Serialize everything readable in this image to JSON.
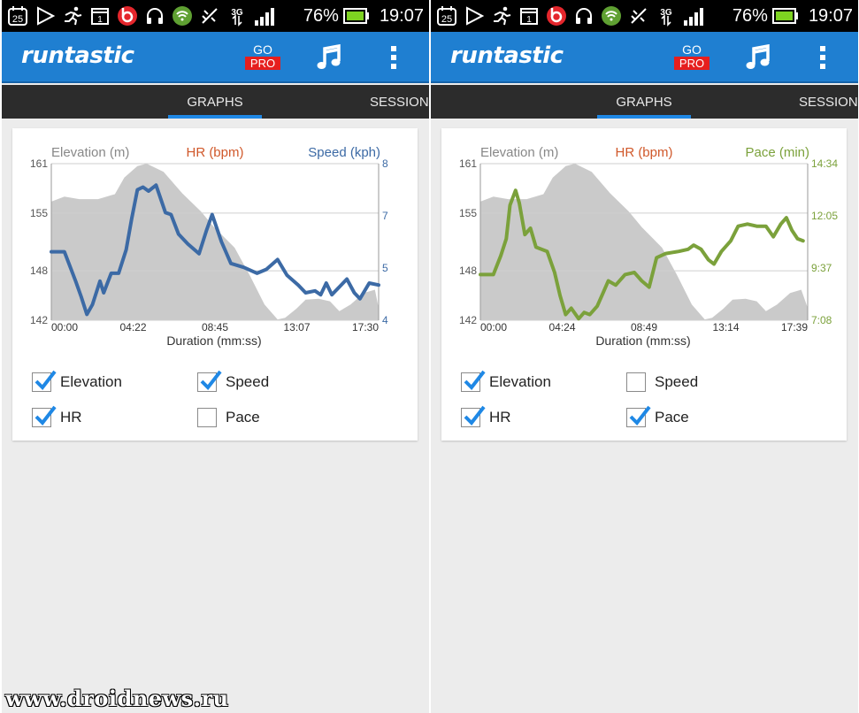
{
  "status_bar": {
    "date_badge": "25",
    "sim_badge": "1",
    "network_label": "3G",
    "battery_percent": "76%",
    "time": "19:07"
  },
  "app": {
    "logo": "runtastic",
    "go_label": "GO",
    "pro_label": "PRO"
  },
  "tabs": {
    "graphs": "GRAPHS",
    "sessions": "SESSION"
  },
  "colors": {
    "appbar": "#1f7fd1",
    "speed": "#3c6aa5",
    "hr": "#d0582a",
    "pace": "#7ba13b",
    "elevation_fill": "#cacaca"
  },
  "watermark": "www.droidnews.ru",
  "panels": [
    {
      "legend": {
        "elevation": "Elevation (m)",
        "hr": "HR (bpm)",
        "right": "Speed (kph)"
      },
      "checkboxes": [
        {
          "label": "Elevation",
          "checked": true
        },
        {
          "label": "Speed",
          "checked": true
        },
        {
          "label": "HR",
          "checked": true
        },
        {
          "label": "Pace",
          "checked": false
        }
      ],
      "chart_data": {
        "type": "line",
        "xlabel": "Duration (mm:ss)",
        "x_ticks": [
          "00:00",
          "04:22",
          "08:45",
          "13:07",
          "17:30"
        ],
        "y_left_label": "Elevation (m)",
        "y_left_ticks": [
          "161",
          "155",
          "148",
          "142"
        ],
        "y_left_range": [
          142,
          161
        ],
        "y_right_label": "Speed (kph)",
        "y_right_ticks": [
          "8",
          "7",
          "5",
          "4"
        ],
        "y_right_range": [
          4,
          8
        ],
        "duration_minutes": 17.5,
        "series": [
          {
            "name": "Elevation (m)",
            "kind": "area",
            "color": "#cacaca",
            "axis": "left",
            "points": [
              [
                0,
                156.4
              ],
              [
                0.7,
                157.0
              ],
              [
                1.5,
                156.7
              ],
              [
                2.5,
                156.7
              ],
              [
                3.4,
                157.3
              ],
              [
                3.9,
                159.3
              ],
              [
                4.6,
                160.7
              ],
              [
                5.1,
                161.0
              ],
              [
                6.0,
                160.0
              ],
              [
                7.0,
                157.4
              ],
              [
                8.0,
                155.2
              ],
              [
                8.7,
                153.3
              ],
              [
                9.8,
                150.8
              ],
              [
                10.6,
                147.5
              ],
              [
                11.4,
                143.9
              ],
              [
                12.1,
                142.1
              ],
              [
                12.5,
                142.3
              ],
              [
                13.1,
                143.4
              ],
              [
                13.6,
                144.5
              ],
              [
                14.3,
                144.6
              ],
              [
                14.9,
                144.3
              ],
              [
                15.4,
                143.1
              ],
              [
                16.0,
                143.9
              ],
              [
                16.7,
                145.3
              ],
              [
                17.3,
                145.7
              ],
              [
                17.5,
                143.5
              ]
            ]
          },
          {
            "name": "Speed (kph)",
            "kind": "line",
            "color": "#3c6aa5",
            "axis": "right",
            "points": [
              [
                0,
                5.75
              ],
              [
                0.7,
                5.75
              ],
              [
                1.3,
                5.0
              ],
              [
                1.6,
                4.6
              ],
              [
                1.9,
                4.15
              ],
              [
                2.2,
                4.4
              ],
              [
                2.6,
                5.0
              ],
              [
                2.8,
                4.7
              ],
              [
                3.2,
                5.2
              ],
              [
                3.6,
                5.2
              ],
              [
                4.0,
                5.8
              ],
              [
                4.3,
                6.6
              ],
              [
                4.6,
                7.33
              ],
              [
                4.9,
                7.4
              ],
              [
                5.2,
                7.3
              ],
              [
                5.6,
                7.45
              ],
              [
                6.1,
                6.75
              ],
              [
                6.4,
                6.7
              ],
              [
                6.8,
                6.2
              ],
              [
                7.3,
                5.95
              ],
              [
                7.9,
                5.7
              ],
              [
                8.3,
                6.3
              ],
              [
                8.6,
                6.7
              ],
              [
                9.1,
                6.0
              ],
              [
                9.6,
                5.45
              ],
              [
                10.3,
                5.35
              ],
              [
                11.0,
                5.2
              ],
              [
                11.5,
                5.3
              ],
              [
                12.1,
                5.55
              ],
              [
                12.6,
                5.15
              ],
              [
                13.2,
                4.9
              ],
              [
                13.6,
                4.7
              ],
              [
                14.1,
                4.75
              ],
              [
                14.4,
                4.65
              ],
              [
                14.7,
                4.95
              ],
              [
                15.0,
                4.65
              ],
              [
                15.4,
                4.85
              ],
              [
                15.8,
                5.05
              ],
              [
                16.2,
                4.7
              ],
              [
                16.5,
                4.55
              ],
              [
                17.0,
                4.95
              ],
              [
                17.5,
                4.9
              ]
            ]
          }
        ]
      }
    },
    {
      "legend": {
        "elevation": "Elevation (m)",
        "hr": "HR (bpm)",
        "right": "Pace (min)"
      },
      "checkboxes": [
        {
          "label": "Elevation",
          "checked": true
        },
        {
          "label": "Speed",
          "checked": false
        },
        {
          "label": "HR",
          "checked": true
        },
        {
          "label": "Pace",
          "checked": true
        }
      ],
      "chart_data": {
        "type": "line",
        "xlabel": "Duration (mm:ss)",
        "x_ticks": [
          "00:00",
          "04:24",
          "08:49",
          "13:14",
          "17:39"
        ],
        "y_left_label": "Elevation (m)",
        "y_left_ticks": [
          "161",
          "155",
          "148",
          "142"
        ],
        "y_left_range": [
          142,
          161
        ],
        "y_right_label": "Pace (min)",
        "y_right_ticks": [
          "14:34",
          "12:05",
          "9:37",
          "7:08"
        ],
        "y_right_range": [
          7.13,
          14.57
        ],
        "duration_minutes": 17.65,
        "series": [
          {
            "name": "Elevation (m)",
            "kind": "area",
            "color": "#cacaca",
            "axis": "left",
            "points": [
              [
                0,
                156.4
              ],
              [
                0.7,
                157.0
              ],
              [
                1.5,
                156.7
              ],
              [
                2.5,
                156.7
              ],
              [
                3.4,
                157.3
              ],
              [
                3.9,
                159.3
              ],
              [
                4.6,
                160.7
              ],
              [
                5.1,
                161.0
              ],
              [
                6.0,
                160.0
              ],
              [
                7.0,
                157.4
              ],
              [
                8.0,
                155.2
              ],
              [
                8.7,
                153.3
              ],
              [
                9.8,
                150.8
              ],
              [
                10.6,
                147.5
              ],
              [
                11.4,
                143.9
              ],
              [
                12.1,
                142.1
              ],
              [
                12.5,
                142.3
              ],
              [
                13.1,
                143.4
              ],
              [
                13.6,
                144.5
              ],
              [
                14.3,
                144.6
              ],
              [
                14.9,
                144.3
              ],
              [
                15.4,
                143.1
              ],
              [
                16.0,
                143.9
              ],
              [
                16.7,
                145.3
              ],
              [
                17.3,
                145.7
              ],
              [
                17.65,
                143.5
              ]
            ]
          },
          {
            "name": "Pace (min)",
            "kind": "line",
            "color": "#7ba13b",
            "axis": "right",
            "points": [
              [
                0,
                9.3
              ],
              [
                0.7,
                9.3
              ],
              [
                1.1,
                10.2
              ],
              [
                1.4,
                11.0
              ],
              [
                1.6,
                12.6
              ],
              [
                1.9,
                13.3
              ],
              [
                2.1,
                12.7
              ],
              [
                2.4,
                11.2
              ],
              [
                2.7,
                11.5
              ],
              [
                3.0,
                10.6
              ],
              [
                3.6,
                10.4
              ],
              [
                4.0,
                9.4
              ],
              [
                4.3,
                8.3
              ],
              [
                4.6,
                7.4
              ],
              [
                4.9,
                7.7
              ],
              [
                5.3,
                7.2
              ],
              [
                5.6,
                7.5
              ],
              [
                5.9,
                7.4
              ],
              [
                6.3,
                7.8
              ],
              [
                6.6,
                8.4
              ],
              [
                6.9,
                9.0
              ],
              [
                7.3,
                8.8
              ],
              [
                7.8,
                9.3
              ],
              [
                8.3,
                9.4
              ],
              [
                8.7,
                9.0
              ],
              [
                9.1,
                8.7
              ],
              [
                9.5,
                10.1
              ],
              [
                10.0,
                10.3
              ],
              [
                10.7,
                10.4
              ],
              [
                11.2,
                10.5
              ],
              [
                11.5,
                10.7
              ],
              [
                11.9,
                10.5
              ],
              [
                12.3,
                10.0
              ],
              [
                12.6,
                9.8
              ],
              [
                13.0,
                10.4
              ],
              [
                13.5,
                10.9
              ],
              [
                13.9,
                11.6
              ],
              [
                14.4,
                11.7
              ],
              [
                14.9,
                11.6
              ],
              [
                15.4,
                11.6
              ],
              [
                15.8,
                11.1
              ],
              [
                16.2,
                11.7
              ],
              [
                16.5,
                12.0
              ],
              [
                16.8,
                11.4
              ],
              [
                17.1,
                11.0
              ],
              [
                17.4,
                10.9
              ]
            ]
          }
        ]
      }
    }
  ]
}
